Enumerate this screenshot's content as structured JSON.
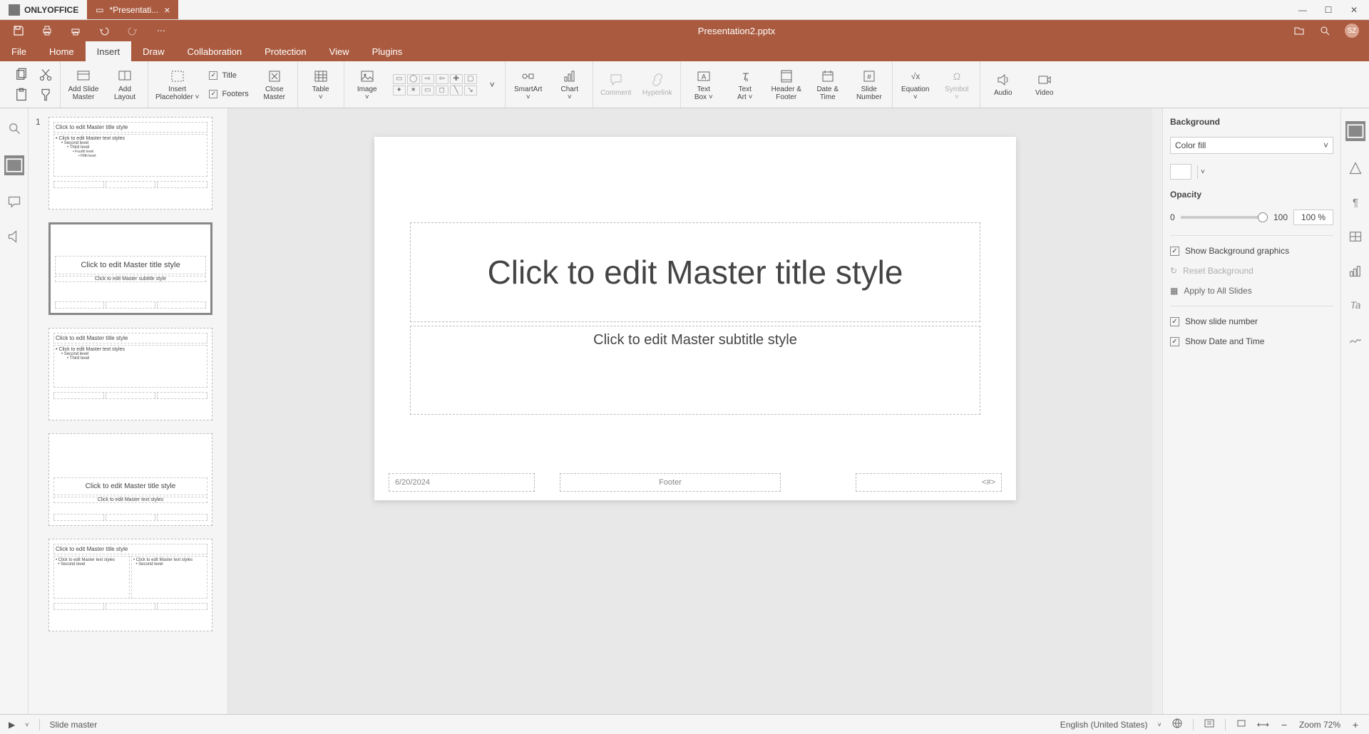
{
  "app": {
    "name": "ONLYOFFICE",
    "tab_file": "*Presentati...",
    "doc_title": "Presentation2.pptx",
    "avatar": "SZ"
  },
  "menu": {
    "tabs": [
      "File",
      "Home",
      "Insert",
      "Draw",
      "Collaboration",
      "Protection",
      "View",
      "Plugins"
    ],
    "active": 2
  },
  "ribbon": {
    "add_slide_master": "Add Slide\nMaster",
    "add_layout": "Add\nLayout",
    "insert_placeholder": "Insert\nPlaceholder ˅",
    "title_chk": "Title",
    "footers_chk": "Footers",
    "close_master": "Close\nMaster",
    "table": "Table\n˅",
    "image": "Image\n˅",
    "smartart": "SmartArt\n˅",
    "chart": "Chart\n˅",
    "comment": "Comment",
    "hyperlink": "Hyperlink",
    "text_box": "Text\nBox ˅",
    "text_art": "Text\nArt ˅",
    "header_footer": "Header &\nFooter",
    "date_time": "Date &\nTime",
    "slide_number": "Slide\nNumber",
    "equation": "Equation\n˅",
    "symbol": "Symbol\n˅",
    "audio": "Audio",
    "video": "Video"
  },
  "thumbs": {
    "num1": "1",
    "master_title": "Click to edit Master title style",
    "master_text": "Click to edit Master text styles",
    "levels": [
      "Second level",
      "Third level",
      "Fourth level",
      "Fifth level"
    ],
    "layout_title": "Click to edit Master title style",
    "layout_sub": "Click to edit Master subtitle style"
  },
  "slide": {
    "title": "Click to edit Master title style",
    "subtitle": "Click to edit Master subtitle style",
    "date": "6/20/2024",
    "footer": "Footer",
    "num": "<#>"
  },
  "right_panel": {
    "background": "Background",
    "fill_type": "Color fill",
    "opacity": "Opacity",
    "opacity_min": "0",
    "opacity_max": "100",
    "opacity_val": "100 %",
    "show_bg_graphics": "Show Background graphics",
    "reset_bg": "Reset Background",
    "apply_all": "Apply to All Slides",
    "show_slide_num": "Show slide number",
    "show_date": "Show Date and Time"
  },
  "status": {
    "mode": "Slide master",
    "lang": "English (United States)",
    "zoom": "Zoom 72%"
  }
}
